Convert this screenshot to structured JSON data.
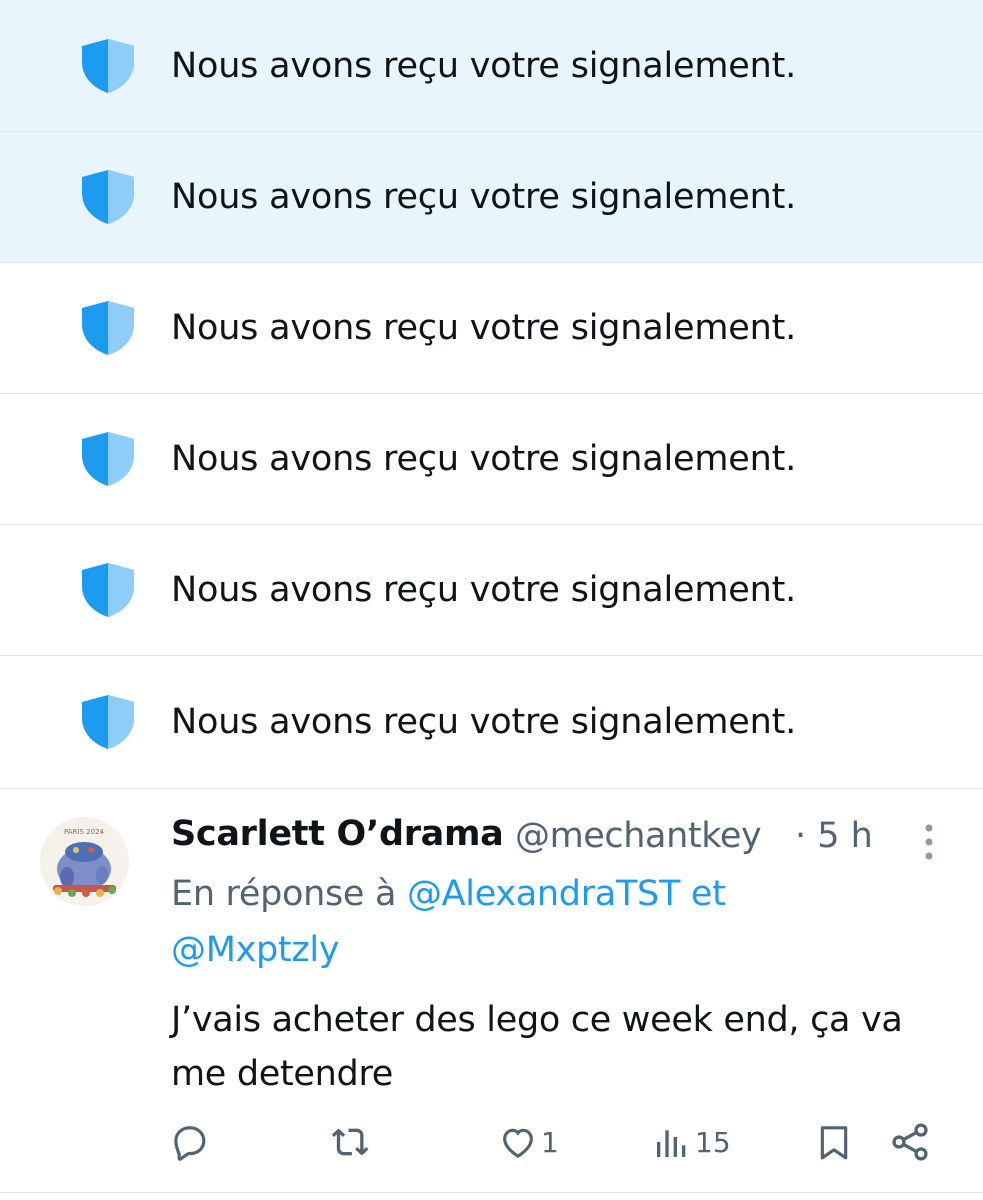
{
  "notices": [
    {
      "text": "Nous avons reçu votre signalement.",
      "highlighted": true
    },
    {
      "text": "Nous avons reçu votre signalement.",
      "highlighted": true
    },
    {
      "text": "Nous avons reçu votre signalement.",
      "highlighted": false
    },
    {
      "text": "Nous avons reçu votre signalement.",
      "highlighted": false
    },
    {
      "text": "Nous avons reçu votre signalement.",
      "highlighted": false
    },
    {
      "text": "Nous avons reçu votre signalement.",
      "highlighted": false
    }
  ],
  "tweet": {
    "display_name": "Scarlett O’drama",
    "handle": "@mechantkey",
    "time": "· 5 h",
    "reply_prefix": "En réponse à ",
    "reply_mention_1": "@AlexandraTST",
    "reply_joiner": " et",
    "reply_mention_2": "@Mxptzly",
    "body": "J’vais acheter des lego ce week end, ça va me detendre",
    "avatar_icon": "paris-2024-illustration-avatar",
    "actions": {
      "reply_icon": "reply-icon",
      "retweet_icon": "retweet-icon",
      "like_icon": "heart-icon",
      "like_count": "1",
      "views_icon": "views-icon",
      "views_count": "15",
      "bookmark_icon": "bookmark-icon",
      "share_icon": "share-icon"
    }
  },
  "colors": {
    "highlight_bg": "#e8f5fd",
    "shield_dark": "#1d9bf0",
    "shield_light": "#8ecdf8",
    "accent": "#1d9bf0",
    "secondary_text": "#536471",
    "divider": "#e4e8eb"
  }
}
